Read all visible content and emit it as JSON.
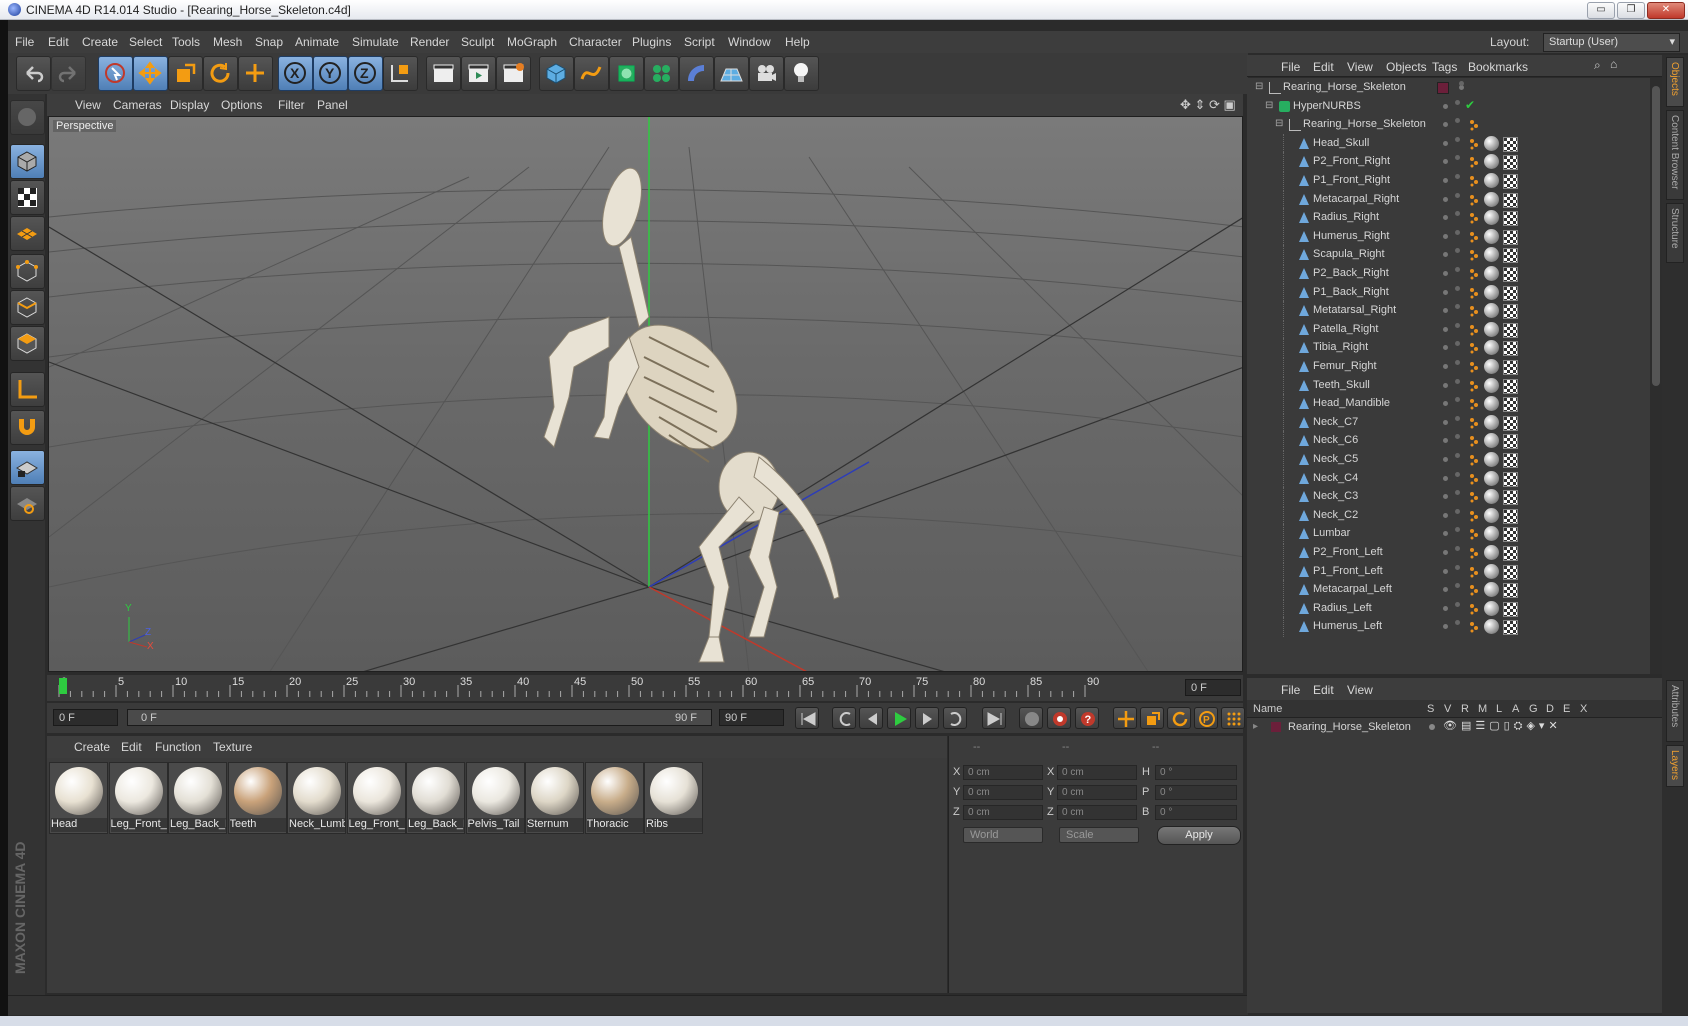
{
  "window": {
    "title": "CINEMA 4D R14.014 Studio - [Rearing_Horse_Skeleton.c4d]",
    "minimize": "▭",
    "maximize": "❐",
    "close": "✕"
  },
  "menubar": {
    "items": [
      "File",
      "Edit",
      "Create",
      "Select",
      "Tools",
      "Mesh",
      "Snap",
      "Animate",
      "Simulate",
      "Render",
      "Sculpt",
      "MoGraph",
      "Character",
      "Plugins",
      "Script",
      "Window",
      "Help"
    ],
    "layout_label": "Layout:",
    "layout_value": "Startup (User)"
  },
  "viewport": {
    "menu": [
      "View",
      "Cameras",
      "Display",
      "Options",
      "Filter",
      "Panel"
    ],
    "camera_label": "Perspective",
    "axis_y": "Y",
    "axis_z": "Z",
    "axis_x": "X"
  },
  "timeline": {
    "ticks": [
      "0",
      "5",
      "10",
      "15",
      "20",
      "25",
      "30",
      "35",
      "40",
      "45",
      "50",
      "55",
      "60",
      "65",
      "70",
      "75",
      "80",
      "85",
      "90"
    ],
    "current_frame": "0 F",
    "start_frame": "0 F",
    "range_start": "0 F",
    "range_end": "90 F",
    "end_frame": "90 F"
  },
  "materials": {
    "menu": [
      "Create",
      "Edit",
      "Function",
      "Texture"
    ],
    "items": [
      {
        "label": "Head",
        "color": "#e8e1d2"
      },
      {
        "label": "Leg_Front_",
        "color": "#ece8df"
      },
      {
        "label": "Leg_Back_F",
        "color": "#e4e0d6"
      },
      {
        "label": "Teeth",
        "color": "#c9a27a"
      },
      {
        "label": "Neck_Lumb",
        "color": "#e3dccd"
      },
      {
        "label": "Leg_Front_",
        "color": "#ebe6dc"
      },
      {
        "label": "Leg_Back_L",
        "color": "#e1ddd4"
      },
      {
        "label": "Pelvis_Tail",
        "color": "#ebe8e0"
      },
      {
        "label": "Sternum",
        "color": "#ddd6c6"
      },
      {
        "label": "Thoracic",
        "color": "#c8ad8a"
      },
      {
        "label": "Ribs",
        "color": "#e6e1d6"
      }
    ]
  },
  "coordinates": {
    "header": [
      "--",
      "--",
      "--"
    ],
    "rows": [
      {
        "l1": "X",
        "v1": "0 cm",
        "l2": "X",
        "v2": "0 cm",
        "l3": "H",
        "v3": "0 °"
      },
      {
        "l1": "Y",
        "v1": "0 cm",
        "l2": "Y",
        "v2": "0 cm",
        "l3": "P",
        "v3": "0 °"
      },
      {
        "l1": "Z",
        "v1": "0 cm",
        "l2": "Z",
        "v2": "0 cm",
        "l3": "B",
        "v3": "0 °"
      }
    ],
    "space": "World",
    "mode": "Scale",
    "apply": "Apply"
  },
  "object_manager": {
    "menu": [
      "File",
      "Edit",
      "View",
      "Objects",
      "Tags",
      "Bookmarks"
    ],
    "objects": [
      {
        "name": "Rearing_Horse_Skeleton",
        "indent": 0,
        "kind": "null"
      },
      {
        "name": "HyperNURBS",
        "indent": 1,
        "kind": "nurbs"
      },
      {
        "name": "Rearing_Horse_Skeleton",
        "indent": 2,
        "kind": "null"
      },
      {
        "name": "Head_Skull",
        "indent": 3,
        "kind": "bone"
      },
      {
        "name": "P2_Front_Right",
        "indent": 3,
        "kind": "bone"
      },
      {
        "name": "P1_Front_Right",
        "indent": 3,
        "kind": "bone"
      },
      {
        "name": "Metacarpal_Right",
        "indent": 3,
        "kind": "bone"
      },
      {
        "name": "Radius_Right",
        "indent": 3,
        "kind": "bone"
      },
      {
        "name": "Humerus_Right",
        "indent": 3,
        "kind": "bone"
      },
      {
        "name": "Scapula_Right",
        "indent": 3,
        "kind": "bone"
      },
      {
        "name": "P2_Back_Right",
        "indent": 3,
        "kind": "bone"
      },
      {
        "name": "P1_Back_Right",
        "indent": 3,
        "kind": "bone"
      },
      {
        "name": "Metatarsal_Right",
        "indent": 3,
        "kind": "bone"
      },
      {
        "name": "Patella_Right",
        "indent": 3,
        "kind": "bone"
      },
      {
        "name": "Tibia_Right",
        "indent": 3,
        "kind": "bone"
      },
      {
        "name": "Femur_Right",
        "indent": 3,
        "kind": "bone"
      },
      {
        "name": "Teeth_Skull",
        "indent": 3,
        "kind": "bone"
      },
      {
        "name": "Head_Mandible",
        "indent": 3,
        "kind": "bone"
      },
      {
        "name": "Neck_C7",
        "indent": 3,
        "kind": "bone"
      },
      {
        "name": "Neck_C6",
        "indent": 3,
        "kind": "bone"
      },
      {
        "name": "Neck_C5",
        "indent": 3,
        "kind": "bone"
      },
      {
        "name": "Neck_C4",
        "indent": 3,
        "kind": "bone"
      },
      {
        "name": "Neck_C3",
        "indent": 3,
        "kind": "bone"
      },
      {
        "name": "Neck_C2",
        "indent": 3,
        "kind": "bone"
      },
      {
        "name": "Lumbar",
        "indent": 3,
        "kind": "bone"
      },
      {
        "name": "P2_Front_Left",
        "indent": 3,
        "kind": "bone"
      },
      {
        "name": "P1_Front_Left",
        "indent": 3,
        "kind": "bone"
      },
      {
        "name": "Metacarpal_Left",
        "indent": 3,
        "kind": "bone"
      },
      {
        "name": "Radius_Left",
        "indent": 3,
        "kind": "bone"
      },
      {
        "name": "Humerus_Left",
        "indent": 3,
        "kind": "bone"
      }
    ]
  },
  "side_tabs": [
    "Objects",
    "Content Browser",
    "Structure",
    "Attributes",
    "Layers"
  ],
  "layer_manager": {
    "menu": [
      "File",
      "Edit",
      "View"
    ],
    "columns": [
      "Name",
      "S",
      "V",
      "R",
      "M",
      "L",
      "A",
      "G",
      "D",
      "E",
      "X"
    ],
    "layers": [
      {
        "name": "Rearing_Horse_Skeleton",
        "color": "#6b1f3a"
      }
    ]
  },
  "brand": "MAXON CINEMA 4D",
  "colors": {
    "accent": "#4f7fb6",
    "orange": "#e8901e",
    "green_axis": "#2ecc40",
    "red_axis": "#e74c3c",
    "blue_axis": "#2d3db8"
  }
}
